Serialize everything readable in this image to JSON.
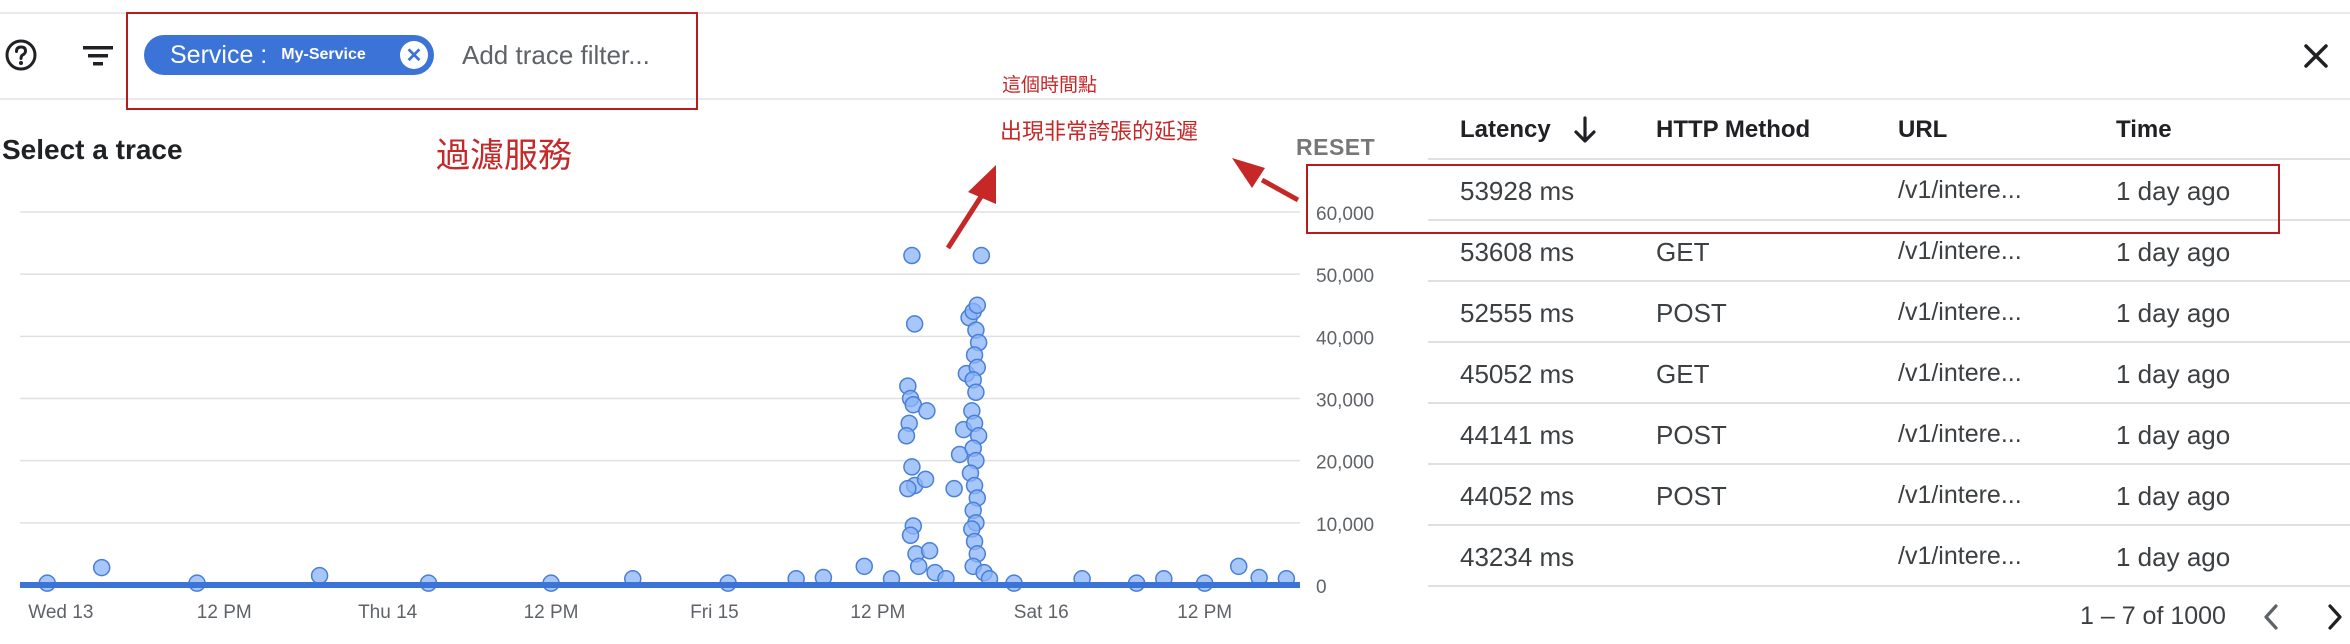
{
  "toolbar": {
    "help_icon": "help-circle-icon",
    "filter_icon": "filter-list-icon",
    "chip": {
      "key": "Service :",
      "value": "My-Service",
      "remove_icon": "remove-chip-icon"
    },
    "add_filter_placeholder": "Add trace filter...",
    "close_icon": "close-icon"
  },
  "main": {
    "title": "Select a trace",
    "reset_label": "RESET"
  },
  "annotations": {
    "filter_note": "過濾服務",
    "time_note_line1": "這個時間點",
    "time_note_line2": "出現非常誇張的延遲",
    "color": "#c62828"
  },
  "chart_data": {
    "type": "scatter",
    "xlabel": "",
    "ylabel": "",
    "x_ticks": [
      "Wed 13",
      "12 PM",
      "Thu 14",
      "12 PM",
      "Fri 15",
      "12 PM",
      "Sat 16",
      "12 PM"
    ],
    "x_tick_hours": [
      0,
      12,
      24,
      36,
      48,
      60,
      72,
      84
    ],
    "xlim": [
      -3,
      91
    ],
    "y_ticks": [
      "60,000",
      "50,000",
      "40,000",
      "30,000",
      "20,000",
      "10,000",
      "0"
    ],
    "y_tick_values": [
      60000,
      50000,
      40000,
      30000,
      20000,
      10000,
      0
    ],
    "ylim": [
      0,
      60000
    ],
    "grid": true,
    "point_color": "#8ab4f8",
    "point_stroke": "#4a7fd8",
    "baseline_color": "#3b73d6",
    "points": [
      {
        "x": -1,
        "y": 300
      },
      {
        "x": 3,
        "y": 2800
      },
      {
        "x": 10,
        "y": 300
      },
      {
        "x": 19,
        "y": 1500
      },
      {
        "x": 27,
        "y": 300
      },
      {
        "x": 36,
        "y": 300
      },
      {
        "x": 42,
        "y": 1000
      },
      {
        "x": 49,
        "y": 300
      },
      {
        "x": 54,
        "y": 1000
      },
      {
        "x": 56,
        "y": 1200
      },
      {
        "x": 59,
        "y": 3000
      },
      {
        "x": 61,
        "y": 1000
      },
      {
        "x": 62.5,
        "y": 53000
      },
      {
        "x": 62.7,
        "y": 42000
      },
      {
        "x": 62.2,
        "y": 32000
      },
      {
        "x": 62.4,
        "y": 30000
      },
      {
        "x": 62.6,
        "y": 29000
      },
      {
        "x": 62.3,
        "y": 26000
      },
      {
        "x": 62.1,
        "y": 24000
      },
      {
        "x": 62.5,
        "y": 19000
      },
      {
        "x": 62.7,
        "y": 16000
      },
      {
        "x": 62.2,
        "y": 15500
      },
      {
        "x": 62.6,
        "y": 9500
      },
      {
        "x": 62.4,
        "y": 8000
      },
      {
        "x": 62.8,
        "y": 5000
      },
      {
        "x": 63.0,
        "y": 3000
      },
      {
        "x": 63.6,
        "y": 28000
      },
      {
        "x": 63.5,
        "y": 17000
      },
      {
        "x": 63.8,
        "y": 5500
      },
      {
        "x": 64.2,
        "y": 2000
      },
      {
        "x": 65.0,
        "y": 1000
      },
      {
        "x": 65.6,
        "y": 15500
      },
      {
        "x": 66.0,
        "y": 21000
      },
      {
        "x": 66.3,
        "y": 25000
      },
      {
        "x": 66.5,
        "y": 34000
      },
      {
        "x": 66.7,
        "y": 43000
      },
      {
        "x": 67.0,
        "y": 44000
      },
      {
        "x": 67.3,
        "y": 45000
      },
      {
        "x": 67.2,
        "y": 41000
      },
      {
        "x": 67.4,
        "y": 39000
      },
      {
        "x": 67.1,
        "y": 37000
      },
      {
        "x": 67.3,
        "y": 35000
      },
      {
        "x": 67.0,
        "y": 33000
      },
      {
        "x": 67.2,
        "y": 31000
      },
      {
        "x": 66.9,
        "y": 28000
      },
      {
        "x": 67.1,
        "y": 26000
      },
      {
        "x": 67.4,
        "y": 24000
      },
      {
        "x": 67.0,
        "y": 22000
      },
      {
        "x": 67.2,
        "y": 20000
      },
      {
        "x": 66.8,
        "y": 18000
      },
      {
        "x": 67.1,
        "y": 16000
      },
      {
        "x": 67.3,
        "y": 14000
      },
      {
        "x": 67.0,
        "y": 12000
      },
      {
        "x": 67.2,
        "y": 10000
      },
      {
        "x": 66.9,
        "y": 9000
      },
      {
        "x": 67.1,
        "y": 7000
      },
      {
        "x": 67.3,
        "y": 5000
      },
      {
        "x": 67.0,
        "y": 3000
      },
      {
        "x": 67.6,
        "y": 53000
      },
      {
        "x": 67.8,
        "y": 2000
      },
      {
        "x": 68.2,
        "y": 1000
      },
      {
        "x": 70.0,
        "y": 300
      },
      {
        "x": 75.0,
        "y": 1000
      },
      {
        "x": 79.0,
        "y": 300
      },
      {
        "x": 81.0,
        "y": 1000
      },
      {
        "x": 84.0,
        "y": 300
      },
      {
        "x": 86.5,
        "y": 3000
      },
      {
        "x": 88.0,
        "y": 1200
      },
      {
        "x": 90.0,
        "y": 1000
      }
    ]
  },
  "table": {
    "columns": [
      "Latency",
      "HTTP Method",
      "URL",
      "Time"
    ],
    "sort_icon": "arrow-downward-icon",
    "rows": [
      {
        "latency": "53928 ms",
        "method": "",
        "url": "/v1/intere...",
        "time": "1 day ago"
      },
      {
        "latency": "53608 ms",
        "method": "GET",
        "url": "/v1/intere...",
        "time": "1 day ago"
      },
      {
        "latency": "52555 ms",
        "method": "POST",
        "url": "/v1/intere...",
        "time": "1 day ago"
      },
      {
        "latency": "45052 ms",
        "method": "GET",
        "url": "/v1/intere...",
        "time": "1 day ago"
      },
      {
        "latency": "44141 ms",
        "method": "POST",
        "url": "/v1/intere...",
        "time": "1 day ago"
      },
      {
        "latency": "44052 ms",
        "method": "POST",
        "url": "/v1/intere...",
        "time": "1 day ago"
      },
      {
        "latency": "43234 ms",
        "method": "",
        "url": "/v1/intere...",
        "time": "1 day ago"
      }
    ]
  },
  "pagination": {
    "range_text": "1 – 7 of 1000",
    "prev_icon": "chevron-left-icon",
    "next_icon": "chevron-right-icon"
  }
}
